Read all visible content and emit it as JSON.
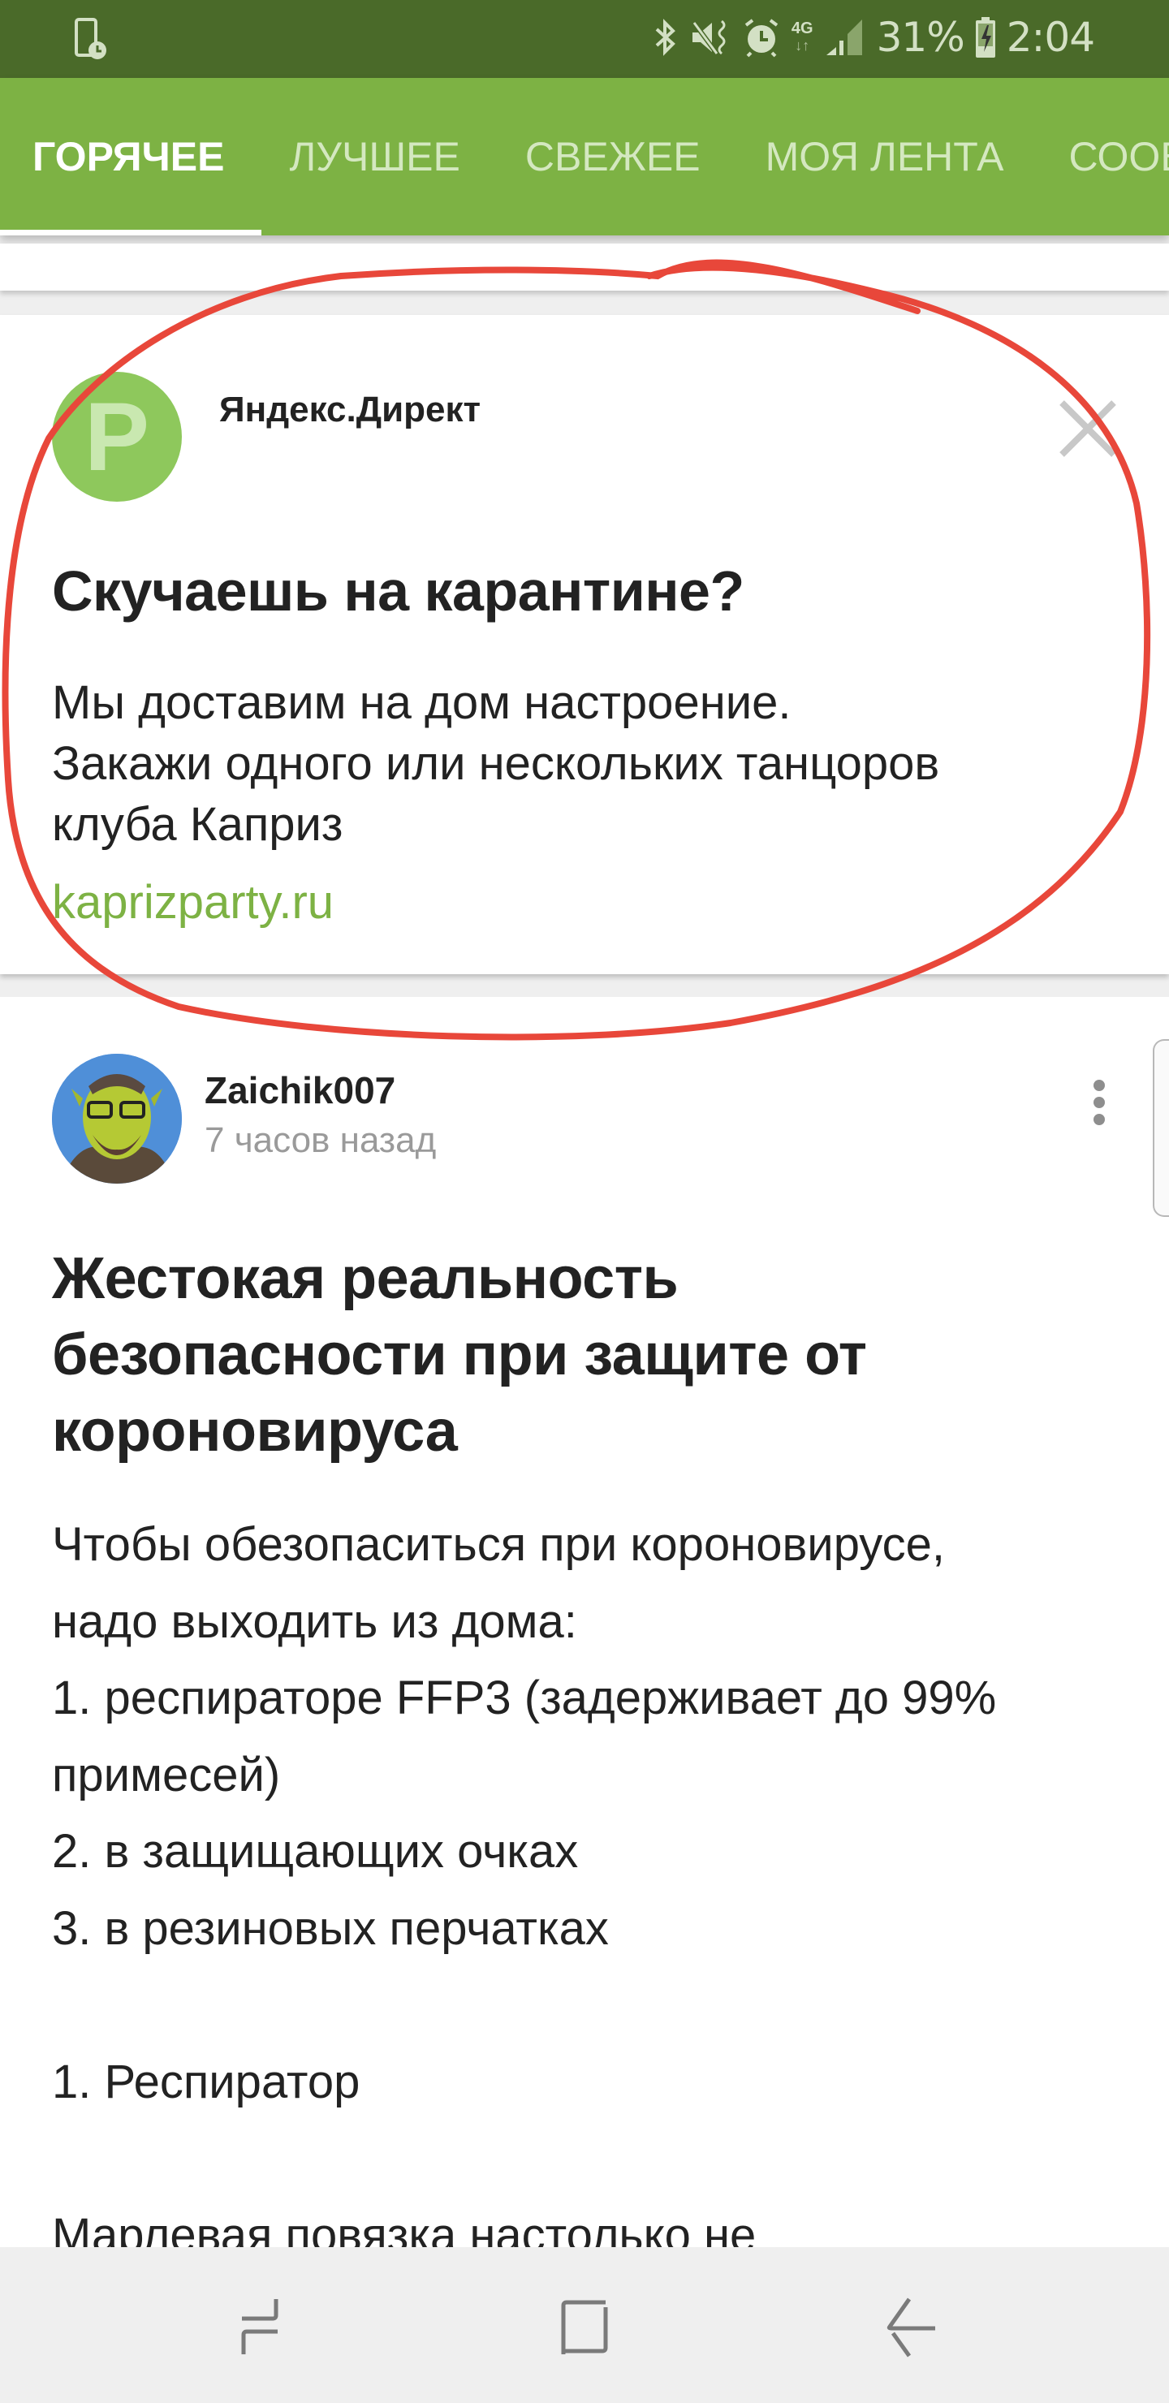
{
  "status_bar": {
    "left_icon": "screen-time-icon",
    "icons": [
      "bluetooth-icon",
      "vibrate-mute-icon",
      "alarm-icon",
      "network-4g-icon",
      "signal-icon",
      "battery-charging-icon"
    ],
    "network_label": "4G",
    "battery_percent": "31%",
    "time": "2:04"
  },
  "tabs": [
    {
      "label": "ГОРЯЧЕЕ",
      "active": true
    },
    {
      "label": "ЛУЧШЕЕ",
      "active": false
    },
    {
      "label": "СВЕЖЕЕ",
      "active": false
    },
    {
      "label": "МОЯ ЛЕНТА",
      "active": false
    },
    {
      "label": "СООБЩЕСТВА",
      "active": false
    }
  ],
  "ad": {
    "logo_letter": "P",
    "source": "Яндекс.Директ",
    "title": "Скучаешь на карантине?",
    "text_lines": [
      "Мы доставим на дом настроение.",
      "Закажи одного или нескольких танцоров",
      "клуба Каприз"
    ],
    "link": "kaprizparty.ru",
    "close_icon": "close-icon"
  },
  "post": {
    "author": "Zaichik007",
    "time": "7 часов назад",
    "title_lines": [
      "Жестокая реальность",
      "безопасности при защите от",
      "короновируса"
    ],
    "body_lines": [
      "Чтобы обезопаситься при короновирусе,",
      "надо выходить из дома:",
      "1. респираторе FFP3 (задерживает до 99%",
      "примесей)",
      "2. в защищающих очках",
      "3. в резиновых перчатках",
      "",
      "1. Респиратор",
      "",
      "Марлевая повязка настолько не"
    ]
  },
  "nav_bar": {
    "buttons": [
      "recent-apps",
      "home",
      "back"
    ]
  },
  "colors": {
    "status_bar": "#4a6a29",
    "brand_green": "#7db244",
    "annotation_red": "#e8473a"
  }
}
